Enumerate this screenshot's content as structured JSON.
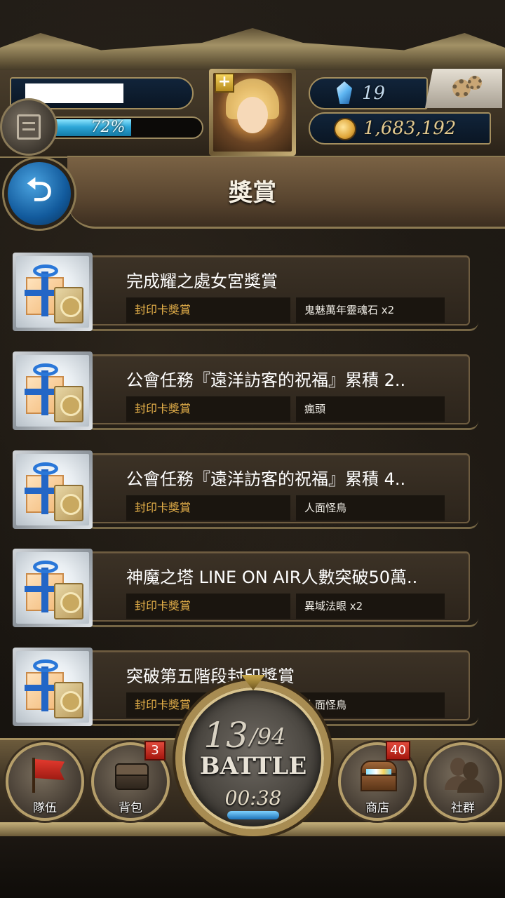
{
  "header": {
    "exp_percent": 72,
    "exp_text": "72%",
    "gems": "19",
    "coins": "1,683,192"
  },
  "page": {
    "title": "獎賞",
    "back_glyph": "⮌"
  },
  "rewards": [
    {
      "title": "完成耀之處女宮獎賞",
      "source": "封印卡獎賞",
      "item": "鬼魅萬年靈魂石 x2"
    },
    {
      "title": "公會任務『遠洋訪客的祝福』累積 2..",
      "source": "封印卡獎賞",
      "item": "瘋頭"
    },
    {
      "title": "公會任務『遠洋訪客的祝福』累積 4..",
      "source": "封印卡獎賞",
      "item": "人面怪鳥"
    },
    {
      "title": "神魔之塔 LINE ON AIR人數突破50萬..",
      "source": "封印卡獎賞",
      "item": "異域法眼 x2"
    },
    {
      "title": "突破第五階段封印獎賞",
      "source": "封印卡獎賞",
      "item": "人面怪鳥"
    }
  ],
  "nav": {
    "team": "隊伍",
    "bag": "背包",
    "bag_badge": "3",
    "shop": "商店",
    "shop_badge": "40",
    "social": "社群"
  },
  "battle": {
    "stamina_current": "13",
    "stamina_max": "/94",
    "label": "BATTLE",
    "timer": "00:38"
  },
  "colors": {
    "accent_gold": "#a38e5e",
    "exp_blue": "#2da7d8",
    "source_text": "#e6b14a",
    "badge_red": "#e24a3c"
  },
  "icons": [
    "menu-icon",
    "gem-icon",
    "coin-icon",
    "settings-gear-icon",
    "back-arrow-icon",
    "gift-box-icon",
    "flag-icon",
    "bag-icon",
    "treasure-chest-icon",
    "friends-icon"
  ]
}
